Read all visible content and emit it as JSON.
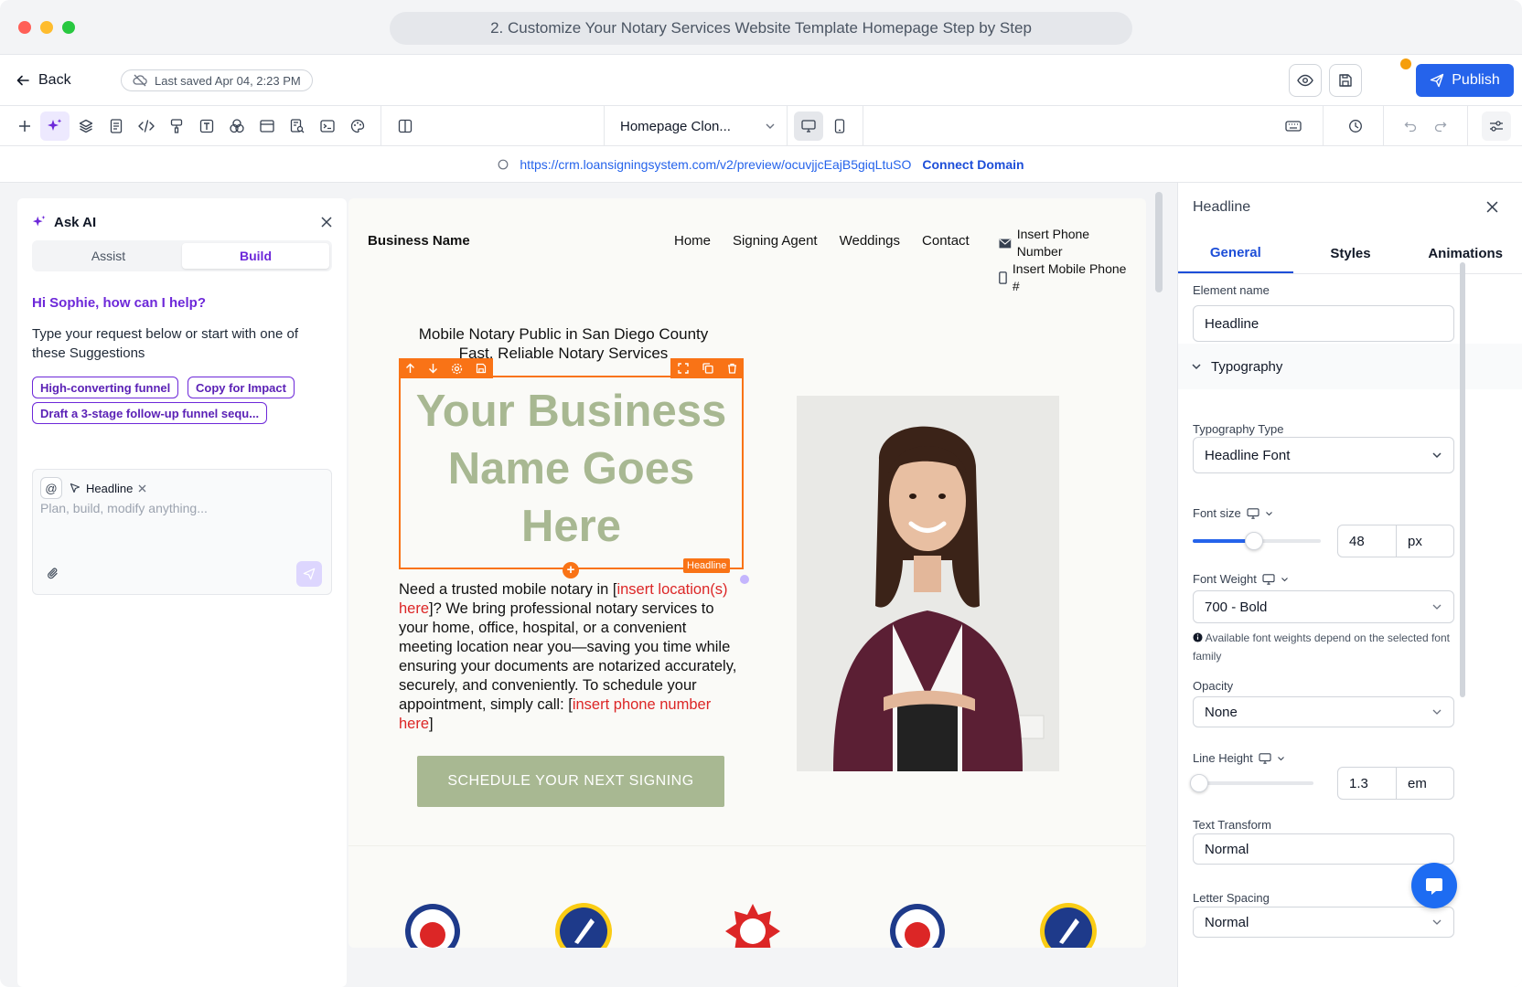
{
  "window": {
    "title": "2. Customize Your Notary Services Website Template Homepage Step by Step"
  },
  "topbar": {
    "back_label": "Back",
    "last_saved": "Last saved Apr 04, 2:23 PM",
    "publish_label": "Publish"
  },
  "toolbar": {
    "tools": [
      "plus-icon",
      "sparkle-icon",
      "layers-icon",
      "page-icon",
      "code-icon",
      "paint-icon",
      "text-icon",
      "shapes-icon",
      "layout-icon",
      "search-doc-icon",
      "terminal-icon",
      "palette-icon",
      "split-icon"
    ],
    "page_selector": "Homepage Clon...",
    "devices": [
      "desktop",
      "mobile"
    ]
  },
  "urlbar": {
    "url": "https://crm.loansigningsystem.com/v2/preview/ocuvjjcEajB5giqLtuSO",
    "connect_label": "Connect Domain"
  },
  "ai_panel": {
    "title": "Ask AI",
    "tabs": [
      {
        "label": "Assist",
        "active": false
      },
      {
        "label": "Build",
        "active": true
      }
    ],
    "greeting": "Hi Sophie, how can I help?",
    "description": "Type your request below or start with one of these Suggestions",
    "suggestions": [
      "High-converting funnel",
      "Copy for Impact",
      "Draft a 3-stage follow-up funnel sequ..."
    ],
    "context_chip": "Headline",
    "placeholder": "Plan, build, modify anything..."
  },
  "site": {
    "business_name": "Business Name",
    "nav": [
      "Home",
      "Signing Agent",
      "Weddings",
      "Contact"
    ],
    "phone": "Insert Phone Number",
    "mobile": "Insert Mobile Phone #",
    "kicker_line1": "Mobile Notary Public in San Diego County",
    "kicker_line2": "Fast, Reliable Notary Services",
    "headline": "Your Business Name Goes Here",
    "headline_tag": "Headline",
    "body_part1": "Need a trusted mobile notary in [",
    "body_red1": "insert location(s) here",
    "body_part2": "]? We bring professional notary services to your home, office, hospital, or a convenient meeting location near you—saving you time while ensuring your documents are notarized accurately, securely, and conveniently. To schedule your appointment, simply call: [",
    "body_red2": "insert phone number here",
    "body_part3": "]",
    "cta": "SCHEDULE YOUR NEXT SIGNING"
  },
  "right_panel": {
    "title": "Headline",
    "tabs": [
      {
        "label": "General",
        "active": true
      },
      {
        "label": "Styles",
        "active": false
      },
      {
        "label": "Animations",
        "active": false
      }
    ],
    "element_name_label": "Element name",
    "element_name": "Headline",
    "section": "Typography",
    "typography_type_label": "Typography Type",
    "typography_type": "Headline Font",
    "font_size_label": "Font size",
    "font_size": "48",
    "font_size_unit": "px",
    "font_size_slider": 0.48,
    "font_weight_label": "Font Weight",
    "font_weight": "700 - Bold",
    "font_weight_note": "Available font weights depend on the selected font family",
    "opacity_label": "Opacity",
    "opacity": "None",
    "line_height_label": "Line Height",
    "line_height": "1.3",
    "line_height_unit": "em",
    "line_height_slider": 0.05,
    "text_transform_label": "Text Transform",
    "text_transform": "Normal",
    "letter_spacing_label": "Letter Spacing",
    "letter_spacing": "Normal"
  },
  "colors": {
    "accent": "#2563eb",
    "ai_purple": "#6d28d9",
    "selection": "#f97316",
    "sage": "#a8b892"
  }
}
